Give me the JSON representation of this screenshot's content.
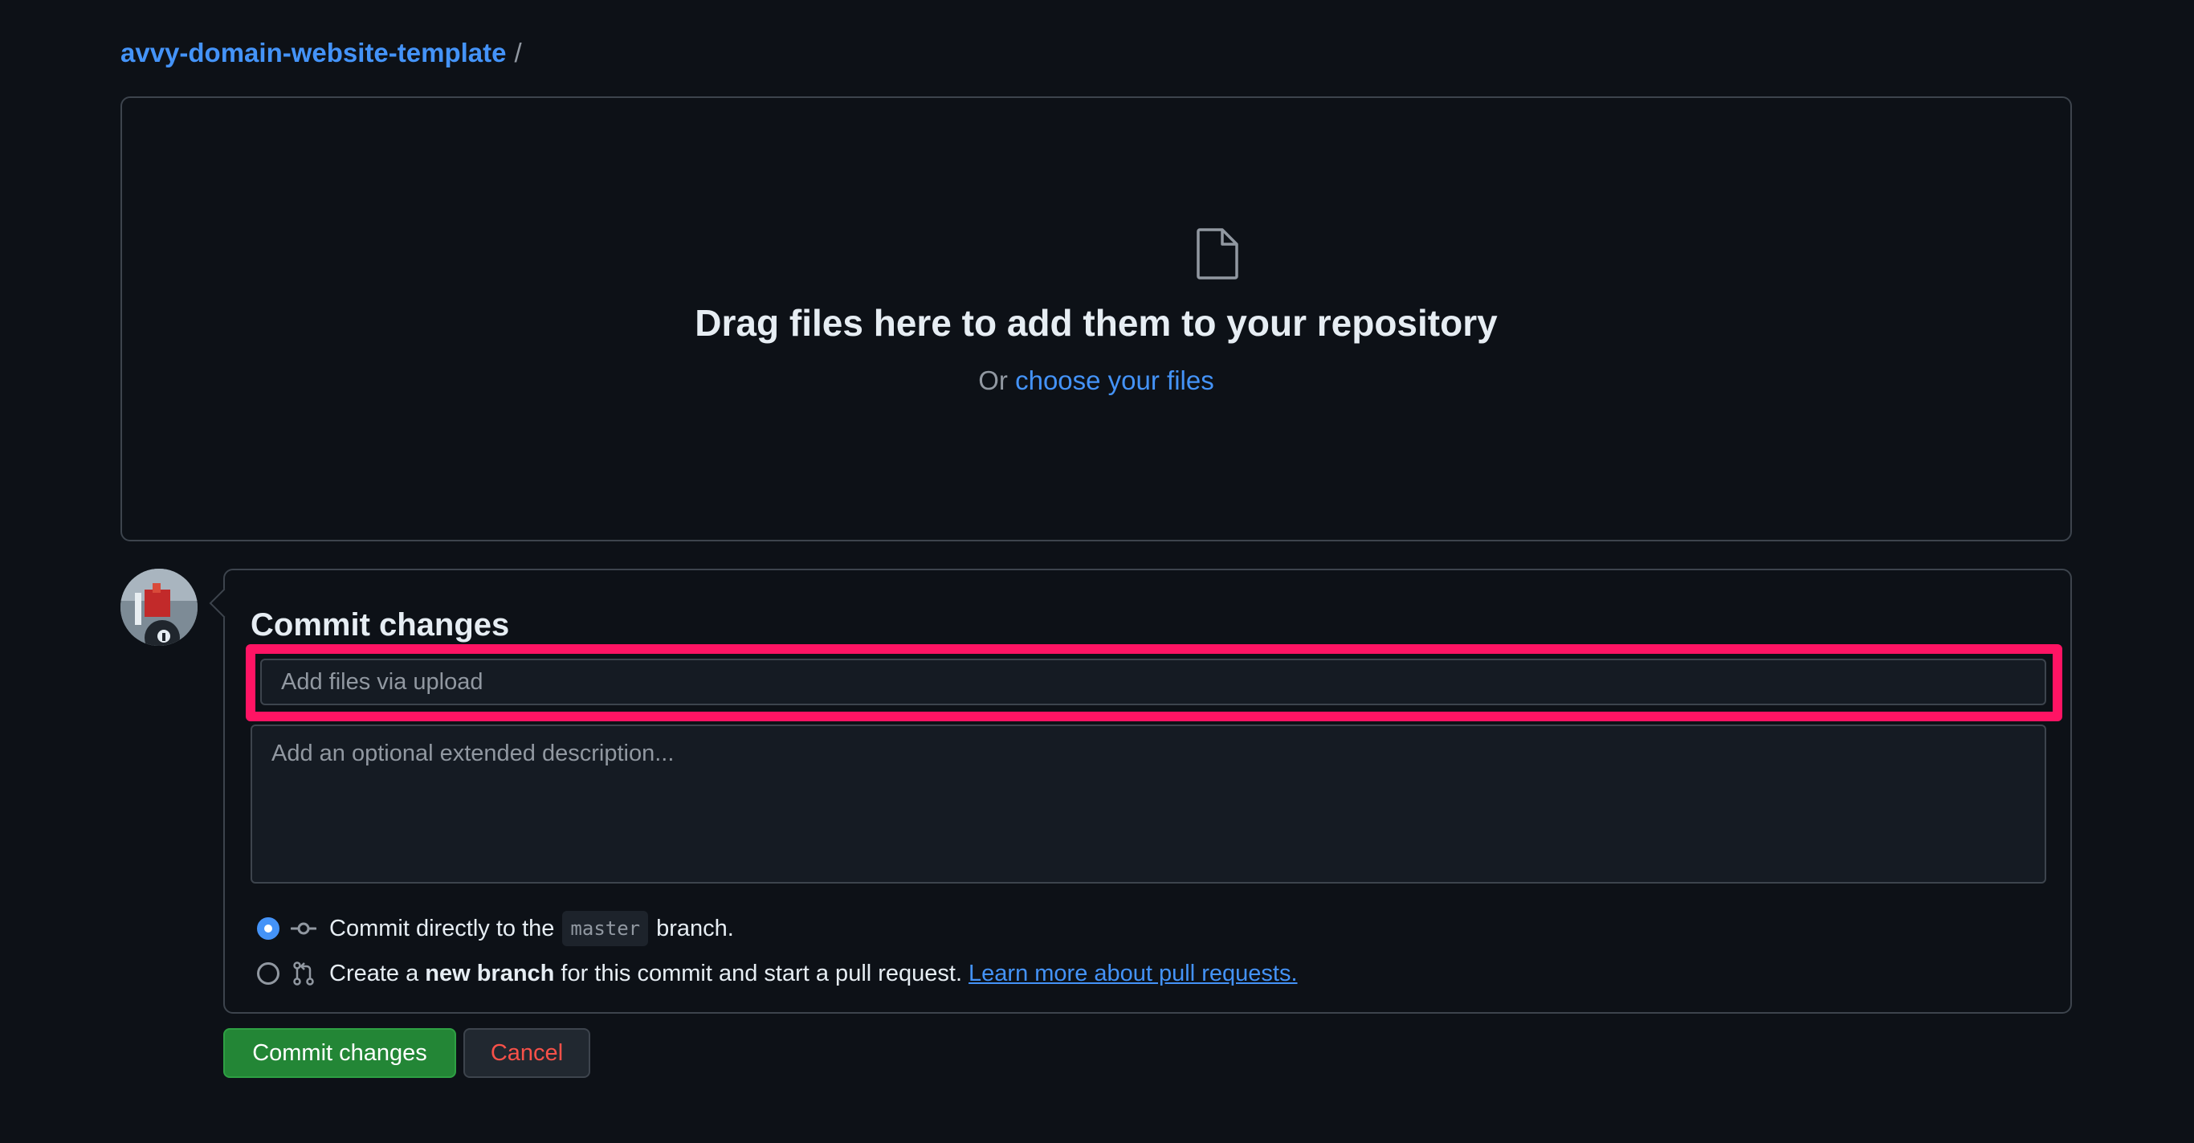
{
  "breadcrumb": {
    "repo": "avvy-domain-website-template",
    "separator": "/"
  },
  "dropzone": {
    "icon": "file-icon",
    "headline": "Drag files here to add them to your repository",
    "prefix": "Or",
    "link": "choose your files"
  },
  "commit": {
    "title": "Commit changes",
    "summary_placeholder": "Add files via upload",
    "description_placeholder": "Add an optional extended description...",
    "option_direct": {
      "before": "Commit directly to the",
      "branch": "master",
      "after": "branch.",
      "selected": true
    },
    "option_new": {
      "before": "Create a",
      "bold": "new branch",
      "after": "for this commit and start a pull request.",
      "link": "Learn more about pull requests.",
      "selected": false
    }
  },
  "buttons": {
    "commit": "Commit changes",
    "cancel": "Cancel"
  },
  "colors": {
    "background": "#0d1117",
    "link": "#4493f8",
    "highlight": "#ff1464",
    "commit_button": "#238636",
    "cancel_text": "#f85149"
  }
}
